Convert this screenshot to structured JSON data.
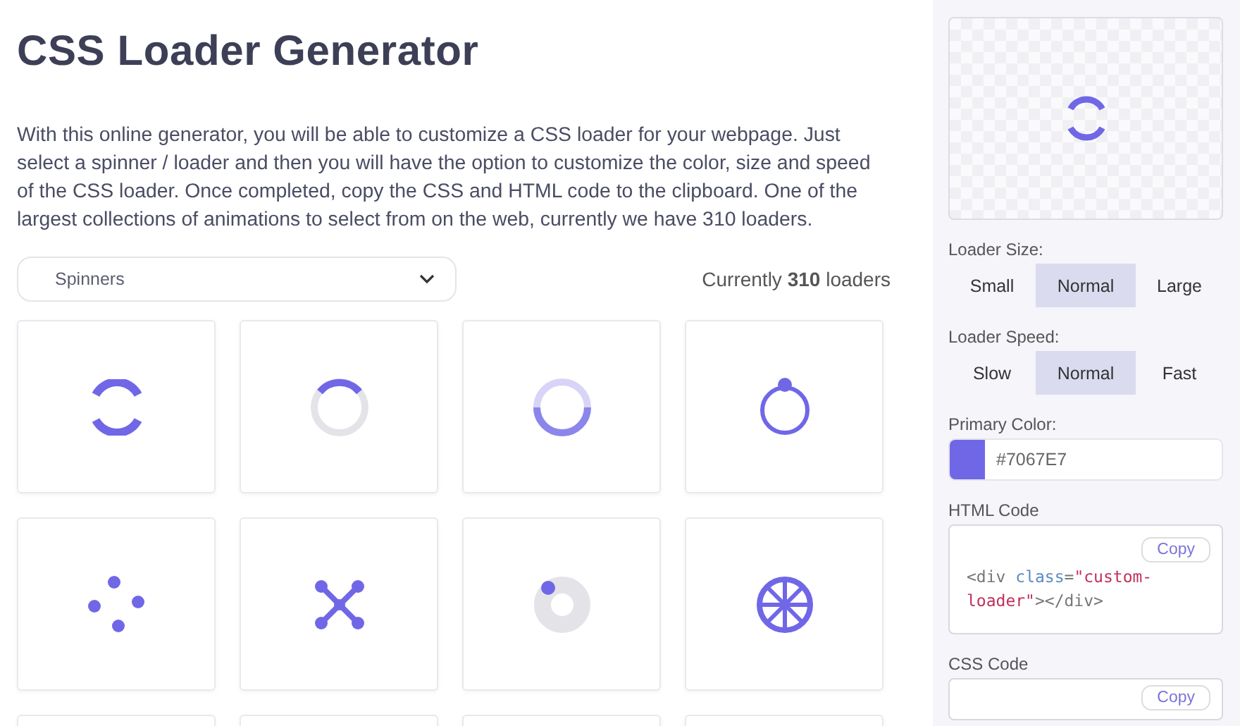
{
  "title": "CSS Loader Generator",
  "intro": "With this online generator, you will be able to customize a CSS loader for your webpage. Just select a spinner / loader and then you will have the option to customize the color, size and speed of the CSS loader. Once completed, copy the CSS and HTML code to the clipboard. One of the largest collections of animations to select from on the web, currently we have 310 loaders.",
  "category_select": {
    "value": "Spinners"
  },
  "count_text": "Currently **310** loaders",
  "loaders": [
    {
      "kind": "arcs"
    },
    {
      "kind": "ring-arc"
    },
    {
      "kind": "fading-ring"
    },
    {
      "kind": "orbit-dot"
    },
    {
      "kind": "dots"
    },
    {
      "kind": "cross"
    },
    {
      "kind": "donut-dot"
    },
    {
      "kind": "wheel"
    },
    {
      "kind": "cut"
    },
    {
      "kind": "cut"
    },
    {
      "kind": "cut"
    },
    {
      "kind": "cut"
    }
  ],
  "sidebar": {
    "size": {
      "label": "Loader Size:",
      "options": [
        {
          "label": "Small",
          "selected": false
        },
        {
          "label": "Normal",
          "selected": true
        },
        {
          "label": "Large",
          "selected": false
        }
      ]
    },
    "speed": {
      "label": "Loader Speed:",
      "options": [
        {
          "label": "Slow",
          "selected": false
        },
        {
          "label": "Normal",
          "selected": true
        },
        {
          "label": "Fast",
          "selected": false
        }
      ]
    },
    "primary_color": {
      "label": "Primary Color:",
      "value": "#7067E7",
      "color": "#7067e7"
    },
    "html_code": {
      "label": "HTML Code",
      "button": "Copy",
      "tag_open": "<div",
      "attr": "class",
      "eq": "=",
      "string": "\"custom-loader\"",
      "close": "></div>"
    },
    "css_code": {
      "label": "CSS Code",
      "button": "Copy"
    }
  }
}
